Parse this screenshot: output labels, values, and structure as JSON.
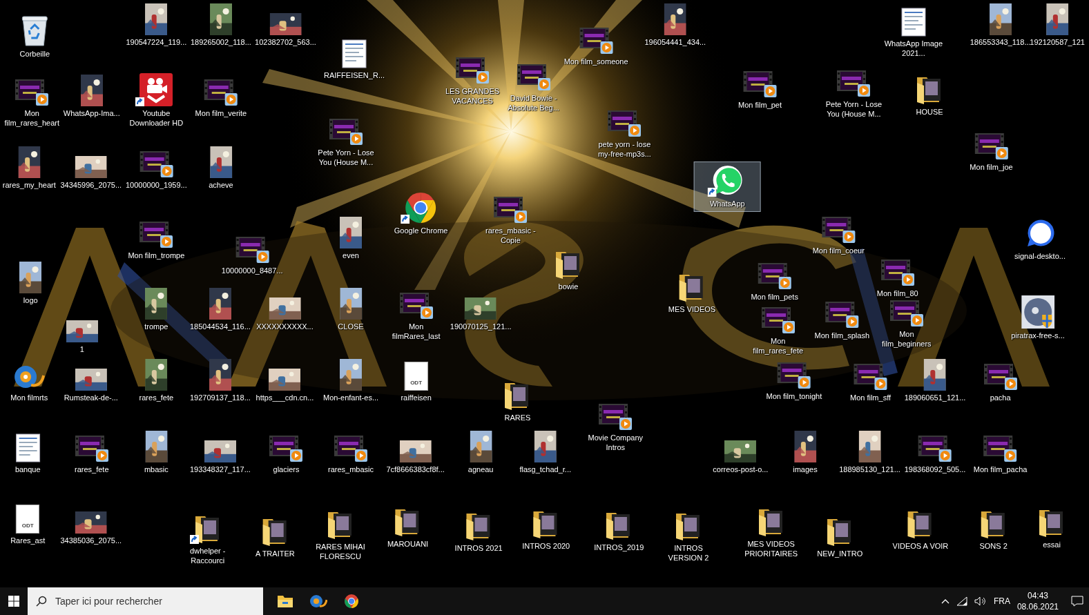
{
  "desktop": {
    "icons": [
      {
        "label": "Corbeille",
        "kind": "trash",
        "selected": false
      },
      {
        "label": "190547224_119...",
        "selected": false
      },
      {
        "label": "189265002_118...",
        "selected": false
      },
      {
        "label": "102382702_563...",
        "selected": false
      },
      {
        "label": "RAIFFEISEN_R...",
        "kind": "document",
        "selected": false
      },
      {
        "label": "LES GRANDES VACANCES",
        "kind": "video",
        "selected": false
      },
      {
        "label": "David Bowie - Absolute Beg...",
        "kind": "video",
        "selected": false
      },
      {
        "label": "Mon film_someone",
        "kind": "video",
        "selected": false
      },
      {
        "label": "196054441_434...",
        "selected": false
      },
      {
        "label": "WhatsApp Image 2021...",
        "kind": "document",
        "selected": false
      },
      {
        "label": "186553343_118...",
        "selected": false
      },
      {
        "label": "192120587_121",
        "selected": false
      },
      {
        "label": "Mon film_rares_heart",
        "kind": "video",
        "selected": false
      },
      {
        "label": "WhatsApp-Ima...",
        "selected": false
      },
      {
        "label": "Youtube Downloader HD",
        "kind": "youtube",
        "shortcut": true,
        "selected": false
      },
      {
        "label": "Mon film_verite",
        "kind": "video",
        "selected": false
      },
      {
        "label": "Pete Yorn - Lose You (House M...",
        "kind": "video",
        "selected": false
      },
      {
        "label": "pete yorn - lose my-free-mp3s...",
        "kind": "video",
        "selected": false
      },
      {
        "label": "WhatsApp",
        "kind": "whatsapp",
        "shortcut": true,
        "selected": true
      },
      {
        "label": "Mon film_pet",
        "kind": "video",
        "selected": false
      },
      {
        "label": "Pete Yorn - Lose You (House M...",
        "kind": "video",
        "selected": false
      },
      {
        "label": "HOUSE",
        "kind": "folder",
        "selected": false
      },
      {
        "label": "Mon film_joe",
        "kind": "video",
        "selected": false
      },
      {
        "label": "rares_my_heart",
        "selected": false
      },
      {
        "label": "34345996_2075...",
        "selected": false
      },
      {
        "label": "10000000_1959...",
        "kind": "video",
        "selected": false
      },
      {
        "label": "acheve",
        "selected": false
      },
      {
        "label": "Google Chrome",
        "kind": "chrome",
        "shortcut": true,
        "selected": false
      },
      {
        "label": "rares_mbasic - Copie",
        "kind": "video",
        "selected": false
      },
      {
        "label": "Mon film_trompe",
        "kind": "video",
        "selected": false
      },
      {
        "label": "10000000_8487...",
        "kind": "video",
        "selected": false
      },
      {
        "label": "even",
        "selected": false
      },
      {
        "label": "bowie",
        "kind": "folder",
        "selected": false
      },
      {
        "label": "Mon film_coeur",
        "kind": "video",
        "selected": false
      },
      {
        "label": "signal-deskto...",
        "kind": "signal",
        "selected": false
      },
      {
        "label": "logo",
        "selected": false
      },
      {
        "label": "1",
        "selected": false
      },
      {
        "label": "trompe",
        "selected": false
      },
      {
        "label": "185044534_116...",
        "selected": false
      },
      {
        "label": "XXXXXXXXXX...",
        "selected": false
      },
      {
        "label": "CLOSE",
        "selected": false
      },
      {
        "label": "Mon filmRares_last",
        "kind": "video",
        "selected": false
      },
      {
        "label": "190070125_121...",
        "selected": false
      },
      {
        "label": "MES VIDEOS",
        "kind": "folder",
        "selected": false
      },
      {
        "label": "Mon film_pets",
        "kind": "video",
        "selected": false
      },
      {
        "label": "Mon film_80",
        "kind": "video",
        "selected": false
      },
      {
        "label": "Mon film_rares_fete",
        "kind": "video",
        "selected": false
      },
      {
        "label": "Mon film_splash",
        "kind": "video",
        "selected": false
      },
      {
        "label": "Mon film_beginners",
        "kind": "video",
        "selected": false
      },
      {
        "label": "piratrax-free-s...",
        "kind": "installer",
        "selected": false
      },
      {
        "label": "Mon filmrts",
        "kind": "moviemaker",
        "selected": false
      },
      {
        "label": "Rumsteak-de-...",
        "selected": false
      },
      {
        "label": "rares_fete",
        "selected": false
      },
      {
        "label": "192709137_118...",
        "selected": false
      },
      {
        "label": "https___cdn.cn...",
        "selected": false
      },
      {
        "label": "Mon-enfant-es...",
        "selected": false
      },
      {
        "label": "raiffeisen",
        "kind": "odt",
        "badge": "ODT",
        "selected": false
      },
      {
        "label": "RARES",
        "kind": "folder",
        "selected": false
      },
      {
        "label": "Movie Company Intros",
        "kind": "video",
        "selected": false
      },
      {
        "label": "Mon film_tonight",
        "kind": "video",
        "selected": false
      },
      {
        "label": "Mon film_sff",
        "kind": "video",
        "selected": false
      },
      {
        "label": "189060651_121...",
        "selected": false
      },
      {
        "label": "pacha",
        "kind": "video",
        "selected": false
      },
      {
        "label": "banque",
        "kind": "document",
        "selected": false
      },
      {
        "label": "rares_fete",
        "kind": "video",
        "selected": false
      },
      {
        "label": "mbasic",
        "selected": false
      },
      {
        "label": "193348327_117...",
        "selected": false
      },
      {
        "label": "glaciers",
        "kind": "video",
        "selected": false
      },
      {
        "label": "rares_mbasic",
        "kind": "video",
        "selected": false
      },
      {
        "label": "7cf8666383cf8f...",
        "selected": false
      },
      {
        "label": "agneau",
        "selected": false
      },
      {
        "label": "flasg_tchad_r...",
        "selected": false
      },
      {
        "label": "correos-post-o...",
        "selected": false
      },
      {
        "label": "images",
        "selected": false
      },
      {
        "label": "188985130_121...",
        "selected": false
      },
      {
        "label": "198368092_505...",
        "kind": "video",
        "selected": false
      },
      {
        "label": "Mon film_pacha",
        "kind": "video",
        "selected": false
      },
      {
        "label": "Rares_ast",
        "kind": "odt",
        "badge": "ODT",
        "selected": false
      },
      {
        "label": "34385036_2075...",
        "selected": false
      },
      {
        "label": "dwhelper - Raccourci",
        "kind": "folder",
        "shortcut": true,
        "selected": false
      },
      {
        "label": "A TRAITER",
        "kind": "folder",
        "selected": false
      },
      {
        "label": "RARES MIHAI FLORESCU",
        "kind": "folder",
        "selected": false
      },
      {
        "label": "MAROUANI",
        "kind": "folder",
        "selected": false
      },
      {
        "label": "INTROS 2021",
        "kind": "folder",
        "selected": false
      },
      {
        "label": "INTROS 2020",
        "kind": "folder",
        "selected": false
      },
      {
        "label": "INTROS_2019",
        "kind": "folder",
        "selected": false
      },
      {
        "label": "INTROS VERSION 2",
        "kind": "folder",
        "selected": false
      },
      {
        "label": "MES VIDEOS PRIORITAIRES",
        "kind": "folder",
        "selected": false
      },
      {
        "label": "NEW_INTRO",
        "kind": "folder",
        "selected": false
      },
      {
        "label": "VIDEOS A VOIR",
        "kind": "folder",
        "selected": false
      },
      {
        "label": "SONS 2",
        "kind": "folder",
        "selected": false
      },
      {
        "label": "essai",
        "kind": "folder",
        "selected": false
      }
    ]
  },
  "taskbar": {
    "search": {
      "placeholder": "Taper ici pour rechercher"
    },
    "pinned": [
      {
        "kind": "explorer"
      },
      {
        "kind": "moviemaker"
      },
      {
        "kind": "chrome"
      }
    ],
    "tray": {
      "language": "FRA",
      "time": "04:43",
      "date": "08.06.2021"
    }
  }
}
